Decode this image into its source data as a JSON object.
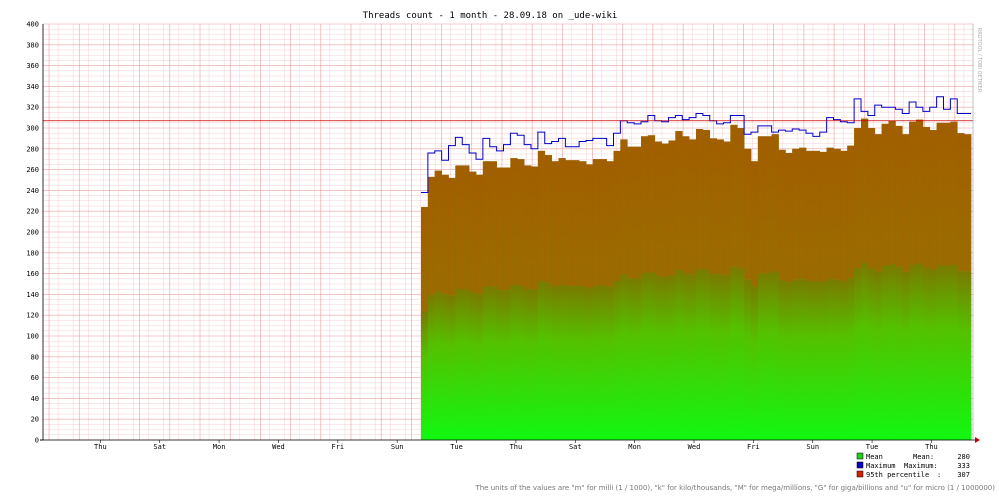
{
  "chart_data": {
    "type": "area",
    "title": "Threads count - 1 month - 28.09.18 on _ude-wiki",
    "ylim": [
      0,
      400
    ],
    "yticks": [
      0,
      20,
      40,
      60,
      80,
      100,
      120,
      140,
      160,
      180,
      200,
      220,
      240,
      260,
      280,
      300,
      320,
      340,
      360,
      380,
      400
    ],
    "xlabels": [
      "Thu",
      "Sat",
      "Mon",
      "Wed",
      "Fri",
      "Sun",
      "Tue",
      "Thu",
      "Sat",
      "Mon",
      "Wed",
      "Fri",
      "Sun",
      "Tue",
      "Thu"
    ],
    "hline": 307,
    "grid": true,
    "legend_position": "bottom-right",
    "series": [
      {
        "name": "Mean",
        "color": "#00cc00",
        "style": "filled-area",
        "values": [
          224,
          253,
          259,
          255,
          252,
          264,
          264,
          258,
          255,
          268,
          268,
          262,
          262,
          271,
          270,
          264,
          263,
          278,
          274,
          268,
          271,
          269,
          269,
          268,
          265,
          270,
          270,
          268,
          278,
          289,
          282,
          282,
          292,
          293,
          287,
          285,
          288,
          297,
          292,
          289,
          299,
          298,
          290,
          289,
          287,
          303,
          300,
          280,
          268,
          292,
          292,
          294,
          279,
          276,
          280,
          281,
          278,
          278,
          277,
          281,
          280,
          278,
          283,
          300,
          309,
          300,
          294,
          304,
          307,
          302,
          294,
          306,
          308,
          301,
          298,
          305,
          305,
          306,
          295,
          294
        ]
      },
      {
        "name": "Maximum",
        "color": "#0000cc",
        "style": "step-line",
        "values": [
          238,
          276,
          278,
          269,
          283,
          291,
          284,
          276,
          270,
          290,
          282,
          278,
          284,
          295,
          293,
          284,
          280,
          296,
          285,
          287,
          290,
          282,
          282,
          287,
          288,
          290,
          290,
          283,
          295,
          307,
          305,
          304,
          306,
          312,
          307,
          306,
          310,
          312,
          308,
          310,
          314,
          312,
          307,
          304,
          305,
          312,
          312,
          294,
          296,
          302,
          302,
          296,
          298,
          297,
          299,
          298,
          295,
          292,
          296,
          310,
          308,
          306,
          305,
          328,
          316,
          312,
          322,
          320,
          320,
          318,
          314,
          325,
          320,
          316,
          320,
          330,
          318,
          328,
          314,
          314
        ]
      },
      {
        "name": "95th percentile",
        "color": "#cc4400",
        "style": "bar-top",
        "values": [
          224,
          253,
          259,
          255,
          252,
          264,
          264,
          258,
          255,
          268,
          268,
          262,
          262,
          271,
          270,
          264,
          263,
          278,
          274,
          268,
          271,
          269,
          269,
          268,
          265,
          270,
          270,
          268,
          278,
          289,
          282,
          282,
          292,
          293,
          287,
          285,
          288,
          297,
          292,
          289,
          299,
          298,
          290,
          289,
          287,
          303,
          300,
          280,
          268,
          292,
          292,
          294,
          279,
          276,
          280,
          281,
          278,
          278,
          277,
          281,
          280,
          278,
          283,
          300,
          309,
          300,
          294,
          304,
          307,
          302,
          294,
          306,
          308,
          301,
          298,
          305,
          305,
          306,
          295,
          294
        ]
      }
    ]
  },
  "legend": [
    {
      "label": "Mean",
      "stat_label": "Mean:",
      "value": "280",
      "color": "#22cc22"
    },
    {
      "label": "Maximum",
      "stat_label": "Maximum:",
      "value": "333",
      "color": "#0000cc"
    },
    {
      "label": "95th percentile",
      "stat_label": ":",
      "value": "307",
      "color": "#cc2200"
    }
  ],
  "footnote": "The units of the values are \"m\" for milli (1 / 1000), \"k\" for kilo/thousands, \"M\" for mega/millions, \"G\" for giga/billions and \"u\" for micro (1 / 1000000)",
  "watermark": "RRDTOOL / TOBI OETIKER"
}
